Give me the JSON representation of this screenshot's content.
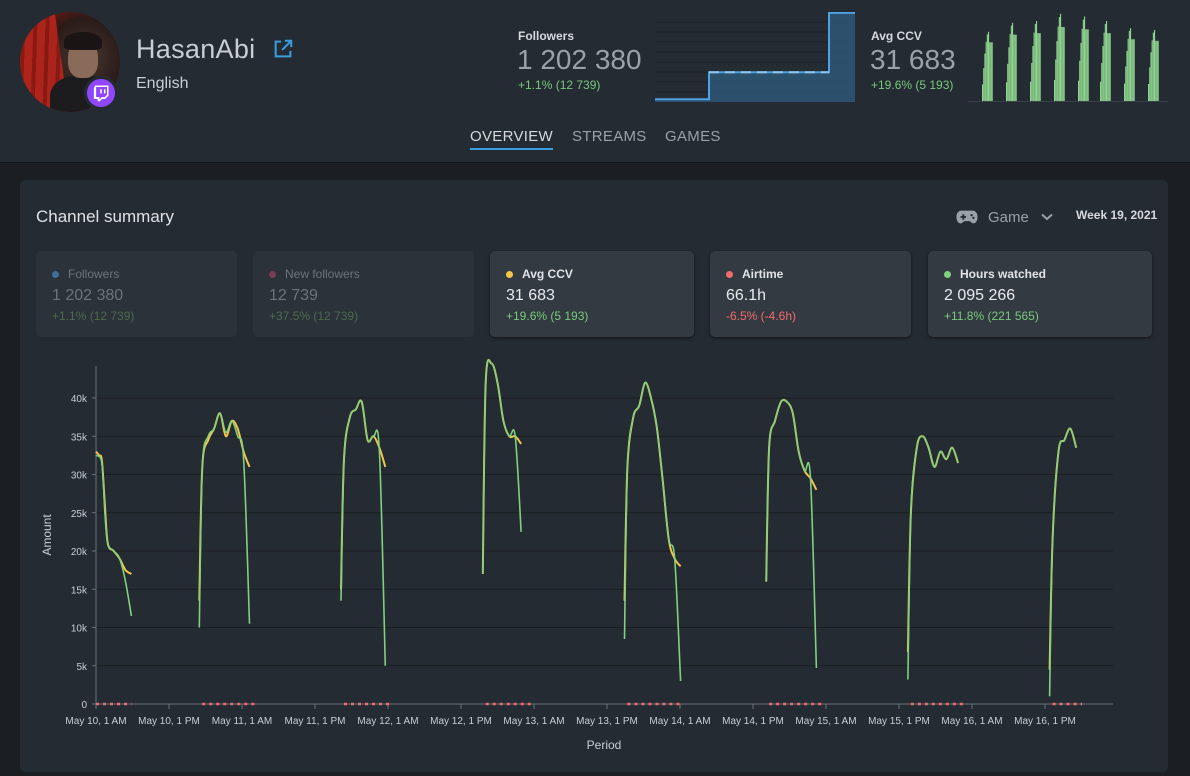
{
  "channel": {
    "name": "HasanAbi",
    "language": "English"
  },
  "header_stats": {
    "followers": {
      "label": "Followers",
      "value": "1 202 380",
      "delta": "+1.1% (12 739)"
    },
    "avg_ccv": {
      "label": "Avg CCV",
      "value": "31 683",
      "delta": "+19.6% (5 193)"
    }
  },
  "tabs": [
    {
      "label": "OVERVIEW",
      "active": true
    },
    {
      "label": "STREAMS",
      "active": false
    },
    {
      "label": "GAMES",
      "active": false
    }
  ],
  "summary": {
    "title": "Channel summary",
    "filter_label": "Game",
    "period": "Week 19, 2021"
  },
  "metrics": [
    {
      "label": "Followers",
      "value": "1 202 380",
      "delta": "+1.1% (12 739)",
      "color": "#3e6f94",
      "active": false,
      "delta_positive": true
    },
    {
      "label": "New followers",
      "value": "12 739",
      "delta": "+37.5% (12 739)",
      "color": "#7a3d56",
      "active": false,
      "delta_positive": true
    },
    {
      "label": "Avg CCV",
      "value": "31 683",
      "delta": "+19.6% (5 193)",
      "color": "#f3c54a",
      "active": true,
      "delta_positive": true
    },
    {
      "label": "Airtime",
      "value": "66.1h",
      "delta": "-6.5% (-4.6h)",
      "color": "#f26b6b",
      "active": true,
      "delta_positive": false
    },
    {
      "label": "Hours watched",
      "value": "2 095 266",
      "delta": "+11.8% (221 565)",
      "color": "#7fd07f",
      "active": true,
      "delta_positive": true
    }
  ],
  "colors": {
    "accent": "#3a9ddf",
    "positive": "#78c97d",
    "negative": "#f26b6b",
    "twitch": "#9146ff",
    "spark_followers": "#4ea2e0",
    "spark_ccv": "#8fd690"
  },
  "chart_data": {
    "type": "line",
    "xlabel": "Period",
    "ylabel": "Amount",
    "ylim": [
      0,
      46000
    ],
    "y_ticks": [
      "0",
      "5k",
      "10k",
      "15k",
      "20k",
      "25k",
      "30k",
      "35k",
      "40k"
    ],
    "y_tick_values": [
      0,
      5000,
      10000,
      15000,
      20000,
      25000,
      30000,
      35000,
      40000
    ],
    "x_ticks": [
      "May 10, 1 AM",
      "May 10, 1 PM",
      "May 11, 1 AM",
      "May 11, 1 PM",
      "May 12, 1 AM",
      "May 12, 1 PM",
      "May 13, 1 AM",
      "May 13, 1 PM",
      "May 14, 1 AM",
      "May 14, 1 PM",
      "May 15, 1 AM",
      "May 15, 1 PM",
      "May 16, 1 AM",
      "May 16, 1 PM"
    ],
    "x_unit": "hours after May 10, 1 AM",
    "streams": [
      {
        "ccv": [
          [
            0,
            33000
          ],
          [
            0.5,
            32500
          ],
          [
            1,
            31800
          ],
          [
            1.5,
            26000
          ],
          [
            2,
            21000
          ],
          [
            3,
            20000
          ],
          [
            4,
            19000
          ],
          [
            5,
            17500
          ],
          [
            6,
            17000
          ]
        ],
        "hours": [
          [
            0,
            32500
          ],
          [
            1,
            31500
          ],
          [
            1.5,
            25000
          ],
          [
            2,
            21000
          ],
          [
            3,
            20000
          ],
          [
            4,
            19000
          ],
          [
            5,
            16000
          ],
          [
            6,
            11500
          ]
        ]
      },
      {
        "ccv": [
          [
            17.5,
            13500
          ],
          [
            18,
            31000
          ],
          [
            19,
            34500
          ],
          [
            20,
            36000
          ],
          [
            21,
            38000
          ],
          [
            22,
            35000
          ],
          [
            23,
            37000
          ],
          [
            24,
            36000
          ],
          [
            25,
            33000
          ],
          [
            26,
            31000
          ]
        ],
        "hours": [
          [
            17.5,
            10000
          ],
          [
            18,
            31000
          ],
          [
            19,
            35000
          ],
          [
            20,
            36000
          ],
          [
            21,
            38000
          ],
          [
            22,
            35500
          ],
          [
            23,
            37000
          ],
          [
            24,
            35000
          ],
          [
            25,
            32000
          ],
          [
            26,
            10500
          ]
        ]
      },
      {
        "ccv": [
          [
            41.5,
            15000
          ],
          [
            42,
            32000
          ],
          [
            43,
            37500
          ],
          [
            44,
            38500
          ],
          [
            45,
            39500
          ],
          [
            46,
            34500
          ],
          [
            47,
            35000
          ],
          [
            48,
            33500
          ],
          [
            49,
            31000
          ]
        ],
        "hours": [
          [
            41.5,
            13500
          ],
          [
            42,
            32000
          ],
          [
            43,
            37500
          ],
          [
            44,
            38500
          ],
          [
            45,
            39500
          ],
          [
            46,
            34500
          ],
          [
            47,
            35000
          ],
          [
            48,
            33000
          ],
          [
            49,
            5000
          ]
        ]
      },
      {
        "ccv": [
          [
            65.5,
            17000
          ],
          [
            66,
            42000
          ],
          [
            67,
            44500
          ],
          [
            68,
            42000
          ],
          [
            69,
            37000
          ],
          [
            70,
            35000
          ],
          [
            71,
            35000
          ],
          [
            72,
            34000
          ]
        ],
        "hours": [
          [
            65.5,
            17000
          ],
          [
            66,
            42000
          ],
          [
            67,
            44500
          ],
          [
            68,
            42000
          ],
          [
            69,
            37000
          ],
          [
            70,
            35000
          ],
          [
            71,
            35000
          ],
          [
            72,
            22500
          ]
        ]
      },
      {
        "ccv": [
          [
            89.5,
            13500
          ],
          [
            90,
            31000
          ],
          [
            91,
            37500
          ],
          [
            92,
            39000
          ],
          [
            93,
            42000
          ],
          [
            94,
            40000
          ],
          [
            95,
            36000
          ],
          [
            96,
            29000
          ],
          [
            97,
            21500
          ],
          [
            98,
            19000
          ],
          [
            99,
            18000
          ]
        ],
        "hours": [
          [
            89.5,
            8500
          ],
          [
            90,
            31000
          ],
          [
            91,
            37500
          ],
          [
            92,
            39000
          ],
          [
            93,
            42000
          ],
          [
            94,
            40000
          ],
          [
            95,
            36000
          ],
          [
            96,
            29000
          ],
          [
            97,
            21500
          ],
          [
            98,
            19000
          ],
          [
            99,
            3000
          ]
        ]
      },
      {
        "ccv": [
          [
            113.5,
            16000
          ],
          [
            114,
            33500
          ],
          [
            115,
            37000
          ],
          [
            116,
            39500
          ],
          [
            117,
            39500
          ],
          [
            118,
            38000
          ],
          [
            119,
            33000
          ],
          [
            120,
            30500
          ],
          [
            121,
            29500
          ],
          [
            122,
            28000
          ]
        ],
        "hours": [
          [
            113.5,
            16000
          ],
          [
            114,
            33500
          ],
          [
            115,
            37000
          ],
          [
            116,
            39500
          ],
          [
            117,
            39500
          ],
          [
            118,
            38000
          ],
          [
            119,
            33000
          ],
          [
            120,
            30500
          ],
          [
            121,
            29500
          ],
          [
            122,
            4700
          ]
        ]
      },
      {
        "ccv": [
          [
            137.5,
            6800
          ],
          [
            138,
            25000
          ],
          [
            139,
            33500
          ],
          [
            140,
            35000
          ],
          [
            141,
            33500
          ],
          [
            142,
            31000
          ],
          [
            143,
            33000
          ],
          [
            144,
            32000
          ],
          [
            145,
            33500
          ],
          [
            146,
            31500
          ]
        ],
        "hours": [
          [
            137.5,
            3200
          ],
          [
            138,
            25000
          ],
          [
            139,
            33500
          ],
          [
            140,
            35000
          ],
          [
            141,
            33500
          ],
          [
            142,
            31000
          ],
          [
            143,
            33000
          ],
          [
            144,
            32000
          ],
          [
            145,
            33500
          ],
          [
            146,
            31500
          ]
        ]
      },
      {
        "ccv": [
          [
            161.5,
            4500
          ],
          [
            162,
            21500
          ],
          [
            163,
            33000
          ],
          [
            164,
            34500
          ],
          [
            165,
            36000
          ],
          [
            166,
            33500
          ]
        ],
        "hours": [
          [
            161.5,
            1000
          ],
          [
            162,
            21500
          ],
          [
            163,
            33000
          ],
          [
            164,
            34500
          ],
          [
            165,
            36000
          ],
          [
            166,
            33500
          ]
        ]
      }
    ],
    "airtime_segments": [
      [
        0,
        6
      ],
      [
        18,
        27
      ],
      [
        42,
        50
      ],
      [
        66,
        74
      ],
      [
        90,
        99.5
      ],
      [
        114,
        123.5
      ],
      [
        138,
        147.5
      ],
      [
        162,
        167
      ]
    ],
    "series_colors": {
      "ccv": "#f3c54a",
      "hours": "#7fd07f",
      "airtime": "#f26b6b"
    }
  },
  "sparks": {
    "followers": [
      0.08,
      0.08,
      0.08,
      0.08,
      0.08,
      0.08,
      0.08,
      0.08,
      0.08,
      0.08,
      0.08,
      0.08,
      0.08,
      0.08,
      0.08,
      0.08,
      0.08,
      0.08,
      0.08,
      0.08,
      0.08,
      0.08,
      0.08,
      0.08,
      0.08,
      0.08,
      0.08,
      0.08,
      0.08,
      0.08,
      0.08,
      0.08,
      0.08,
      0.08,
      0.08,
      0.08,
      0.08,
      0.08,
      0.08,
      0.08,
      0.08,
      0.08,
      0.08,
      0.08,
      0.08,
      0.08,
      0.08,
      0.08,
      0.08,
      0.08,
      0.08,
      0.08,
      0.08,
      0.08,
      0.08,
      0.08,
      0.08,
      0.08,
      0.08,
      0.08,
      0.08,
      0.08,
      0.08,
      0.08,
      0.08,
      0.08,
      0.08,
      0.08,
      0.08,
      0.08,
      0.08,
      0.08,
      0.08,
      0.08,
      0.08,
      0.08,
      0.08,
      0.08,
      0.08,
      0.08,
      0.08,
      0.08,
      0.08,
      0.08,
      0.08,
      0.08,
      0.08,
      0.08,
      0.08,
      0.08,
      0.08,
      0.08,
      0.08,
      0.08,
      0.08,
      0.08,
      0.08,
      0.08,
      0.08,
      0.08,
      0.08,
      0.08,
      0.08,
      0.08,
      0.08,
      0.08,
      0.08,
      0.08,
      0.08,
      0.08,
      0.08,
      0.08,
      0.08,
      0.08,
      0.08,
      0.08,
      0.08,
      0.08,
      0.08,
      0.08,
      0.08,
      0.08,
      0.08,
      0.08,
      0.08,
      0.08,
      0.08,
      0.08,
      0.08,
      0.08,
      0.08,
      0.08,
      0.08,
      0.08,
      0.08,
      0.08,
      0.08,
      0.08,
      0.08,
      0.08,
      0.08,
      0.08,
      0.08,
      0.08,
      0.08,
      0.08,
      0.08,
      0.08,
      0.08,
      0.08,
      0.08,
      0.08,
      0.08,
      0.08,
      0.08,
      0.08,
      0.08,
      0.08,
      0.08,
      0.08,
      0.08,
      0.08,
      0.08,
      0.08,
      0.08,
      0.08,
      0.08,
      0.08,
      0.08,
      0.08,
      0.08,
      0.08,
      0.08,
      0.08,
      0.08,
      0.08,
      0.08,
      0.08,
      0.08,
      0.08,
      0.08,
      0.08,
      0.08,
      0.08,
      0.08,
      0.08,
      0.08,
      0.08,
      0.08,
      0.08,
      0.08,
      0.08
    ],
    "followers_steps": [
      [
        0,
        0.03
      ],
      [
        0.27,
        0.33
      ],
      [
        0.87,
        0.99
      ]
    ],
    "ccv_streams": 8
  }
}
